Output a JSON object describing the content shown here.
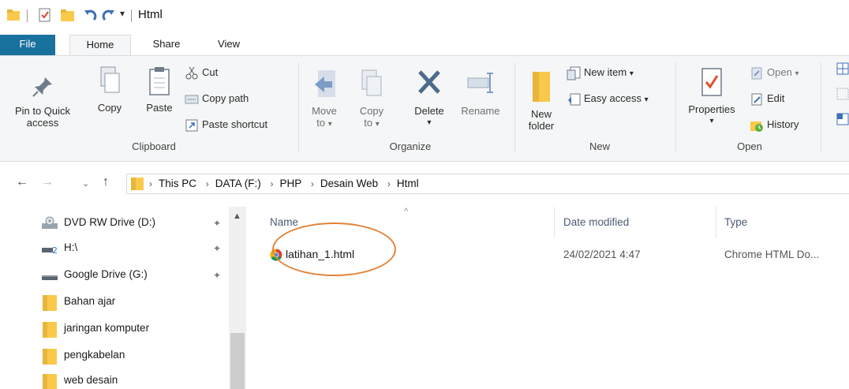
{
  "window": {
    "title": "Html"
  },
  "tabs": [
    {
      "label": "File"
    },
    {
      "label": "Home"
    },
    {
      "label": "Share"
    },
    {
      "label": "View"
    }
  ],
  "ribbon": {
    "clipboard": {
      "group_label": "Clipboard",
      "pin_label_1": "Pin to Quick",
      "pin_label_2": "access",
      "copy_label": "Copy",
      "paste_label": "Paste",
      "cut_label": "Cut",
      "copy_path_label": "Copy path",
      "paste_shortcut_label": "Paste shortcut"
    },
    "organize": {
      "group_label": "Organize",
      "move_label_1": "Move",
      "move_label_2": "to",
      "copy_label_1": "Copy",
      "copy_label_2": "to",
      "delete_label": "Delete",
      "rename_label": "Rename"
    },
    "new": {
      "group_label": "New",
      "new_folder_1": "New",
      "new_folder_2": "folder",
      "new_item_label": "New item",
      "easy_access_label": "Easy access"
    },
    "open": {
      "group_label": "Open",
      "properties_label": "Properties",
      "open_label": "Open",
      "edit_label": "Edit",
      "history_label": "History"
    }
  },
  "address": {
    "crumbs": [
      "This PC",
      "DATA (F:)",
      "PHP",
      "Desain Web",
      "Html"
    ]
  },
  "nav_pane": {
    "items": [
      {
        "label": "DVD RW Drive (D:)",
        "icon": "dvd-drive-icon"
      },
      {
        "label": "H:\\",
        "icon": "network-drive-icon"
      },
      {
        "label": "Google Drive (G:)",
        "icon": "drive-icon"
      },
      {
        "label": "Bahan ajar",
        "icon": "folder-icon"
      },
      {
        "label": "jaringan komputer",
        "icon": "folder-icon"
      },
      {
        "label": "pengkabelan",
        "icon": "folder-icon"
      },
      {
        "label": "web desain",
        "icon": "folder-icon"
      }
    ]
  },
  "file_list": {
    "columns": {
      "name": "Name",
      "date": "Date modified",
      "type": "Type"
    },
    "rows": [
      {
        "name": "latihan_1.html",
        "date": "24/02/2021 4:47",
        "type": "Chrome HTML Do..."
      }
    ]
  },
  "colors": {
    "file_tab": "#19719e",
    "highlight_ring": "#e3843a",
    "folder": "#f8c94a"
  }
}
